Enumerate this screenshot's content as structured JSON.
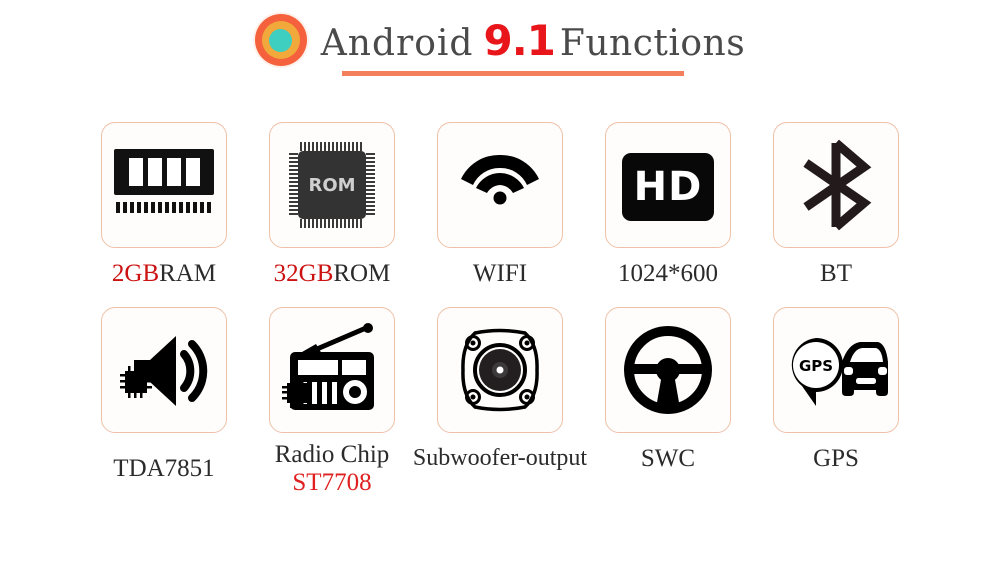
{
  "header": {
    "logo_name": "android-logo",
    "title_prefix": "Android",
    "version": "9.1",
    "title_suffix": "Functions",
    "accent_color": "#f3805b",
    "version_color": "#e8161b"
  },
  "features": {
    "row1": [
      {
        "icon": "ram-module-icon",
        "label_highlight": "2GB",
        "label_rest": "RAM",
        "highlight_color": "#cc1111"
      },
      {
        "icon": "rom-chip-icon",
        "icon_text": "ROM",
        "label_highlight": "32GB",
        "label_rest": "ROM",
        "highlight_color": "#cc1111"
      },
      {
        "icon": "wifi-icon",
        "label": "WIFI"
      },
      {
        "icon": "hd-badge-icon",
        "icon_text": "HD",
        "label": "1024*600"
      },
      {
        "icon": "bluetooth-icon",
        "label": "BT"
      }
    ],
    "row2": [
      {
        "icon": "speaker-amplifier-chip-icon",
        "label": "TDA7851"
      },
      {
        "icon": "radio-chip-icon",
        "label_line1": "Radio Chip",
        "label_line2": "ST7708",
        "line2_color": "#e02020"
      },
      {
        "icon": "subwoofer-icon",
        "label": "Subwoofer-output"
      },
      {
        "icon": "steering-wheel-icon",
        "label": "SWC"
      },
      {
        "icon": "gps-car-icon",
        "icon_text": "GPS",
        "label": "GPS"
      }
    ]
  }
}
